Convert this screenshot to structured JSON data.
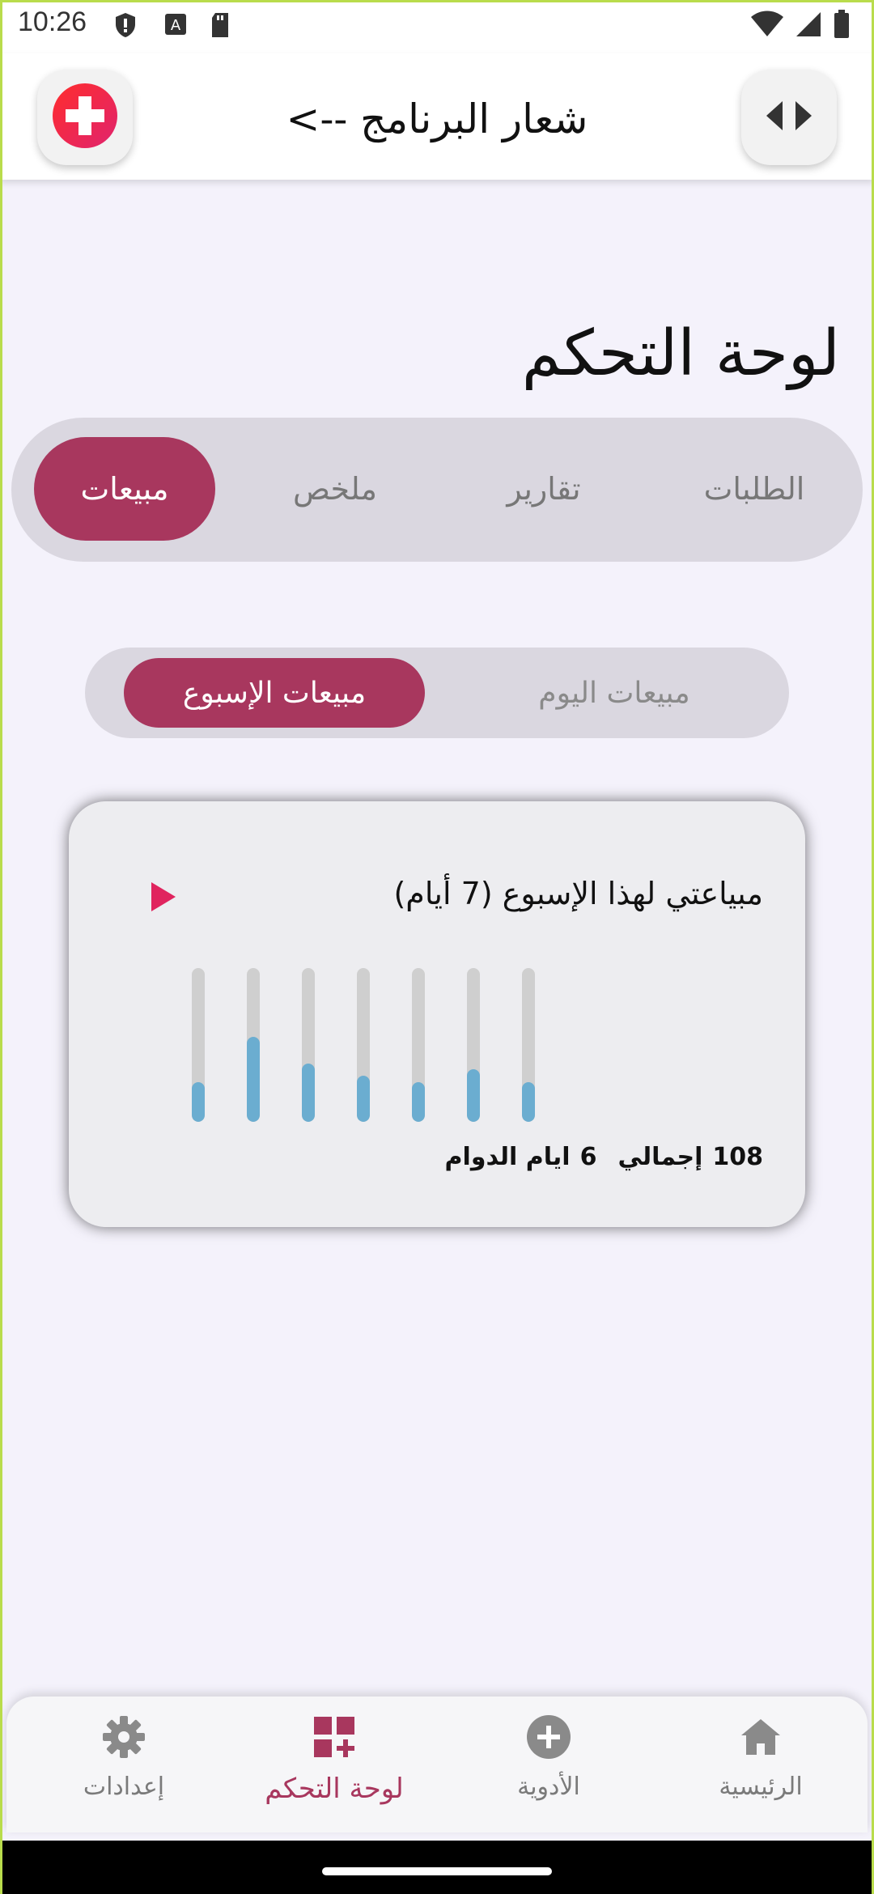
{
  "status_bar": {
    "time": "10:26"
  },
  "app_bar": {
    "title": "شعار البرنامج -->"
  },
  "page": {
    "title": "لوحة التحكم"
  },
  "tabs": [
    {
      "label": "الطلبات",
      "active": false
    },
    {
      "label": "تقارير",
      "active": false
    },
    {
      "label": "ملخص",
      "active": false
    },
    {
      "label": "مبيعات",
      "active": true
    }
  ],
  "subtabs": [
    {
      "label": "مبيعات اليوم",
      "active": false
    },
    {
      "label": "مبيعات الإسبوع",
      "active": true
    }
  ],
  "card": {
    "title": "مبياعتي لهذا الإسبوع  (7  أيام)",
    "bars": [
      0.26,
      0.55,
      0.38,
      0.3,
      0.26,
      0.34,
      0.26
    ],
    "footer": {
      "total_value": "108",
      "total_label": "إجمالي",
      "days_value": "6",
      "days_label": "ايام الدوام"
    }
  },
  "bottom_nav": [
    {
      "label": "الرئيسية",
      "icon": "home-icon",
      "active": false
    },
    {
      "label": "الأدوية",
      "icon": "plus-circle-icon",
      "active": false
    },
    {
      "label": "لوحة التحكم",
      "icon": "dashboard-icon",
      "active": true
    },
    {
      "label": "إعدادات",
      "icon": "gear-icon",
      "active": false
    }
  ],
  "colors": {
    "accent": "#a8375e",
    "bar_fill": "#6badd0",
    "play": "#e0245e",
    "background": "#f4f2fb"
  }
}
